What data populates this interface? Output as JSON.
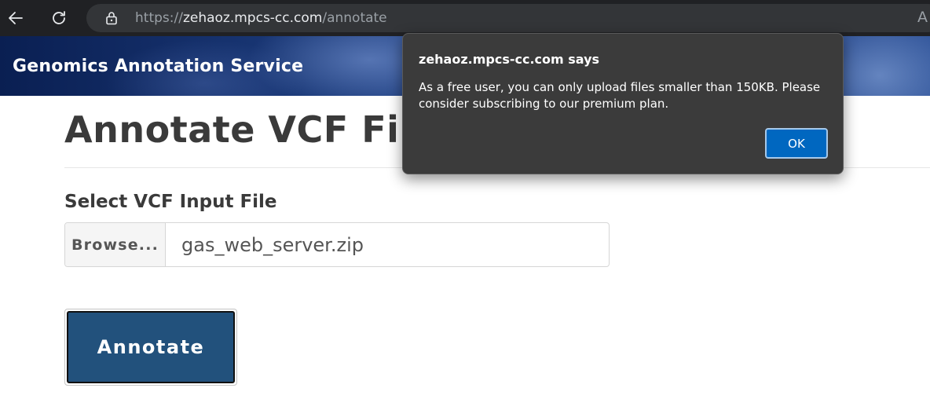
{
  "browser": {
    "url_prefix": "https://",
    "url_host": "zehaoz.mpcs-cc.com",
    "url_path": "/annotate",
    "read_aloud_glyph": "A",
    "icons": [
      "back-arrow-icon",
      "reload-icon",
      "lock-icon",
      "read-aloud-icon"
    ]
  },
  "banner": {
    "title": "Genomics Annotation Service"
  },
  "page": {
    "title": "Annotate VCF File",
    "field_label": "Select VCF Input File",
    "browse_label": "Browse...",
    "file_name": "gas_web_server.zip",
    "submit_label": "Annotate"
  },
  "dialog": {
    "title": "zehaoz.mpcs-cc.com says",
    "message": "As a free user, you can only upload files smaller than 150KB. Please consider subscribing to our premium plan.",
    "ok_label": "OK"
  },
  "colors": {
    "browser_chrome": "#202124",
    "banner_dark": "#0a1f52",
    "annotate_button": "#22517c",
    "dialog_bg": "#3b3b3b",
    "ok_button": "#0067c0"
  }
}
